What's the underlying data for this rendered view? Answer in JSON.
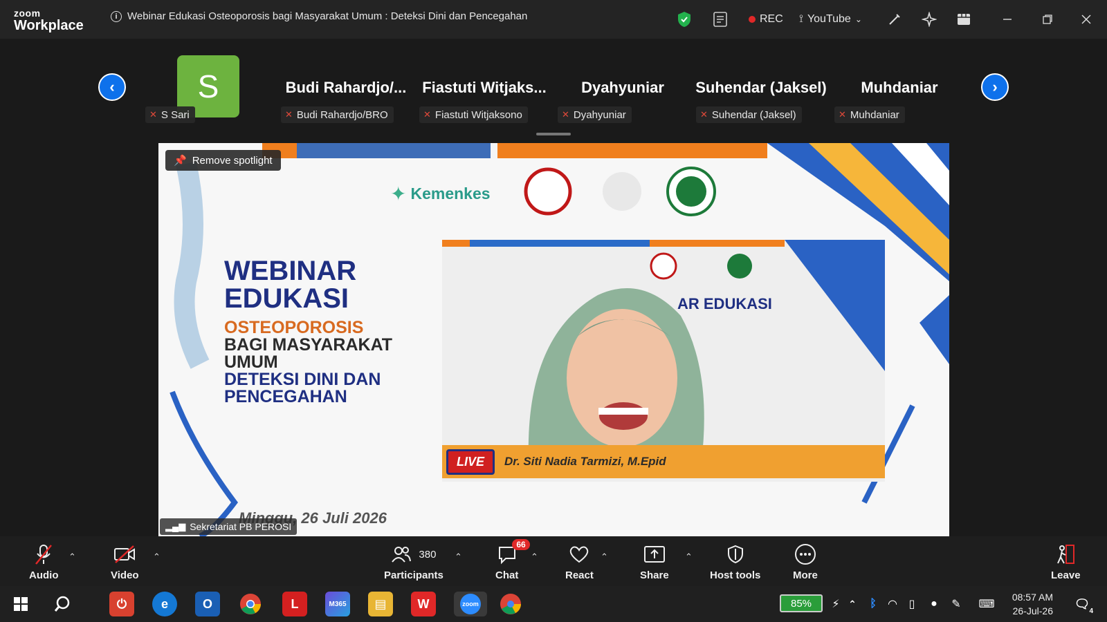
{
  "app": {
    "logo_top": "zoom",
    "logo_bottom": "Workplace"
  },
  "meeting": {
    "title": "Webinar Edukasi Osteoporosis bagi Masyarakat Umum : Deteksi Dini dan Pencegahan"
  },
  "titlebar": {
    "rec_label": "REC",
    "stream_label": "YouTube"
  },
  "participants_strip": [
    {
      "big": "",
      "avatar_letter": "S",
      "name": "S Sari"
    },
    {
      "big": "Budi  Rahardjo/...",
      "name": "Budi Rahardjo/BRO"
    },
    {
      "big": "Fiastuti  Witjaks...",
      "name": "Fiastuti Witjaksono"
    },
    {
      "big": "Dyahyuniar",
      "name": "Dyahyuniar"
    },
    {
      "big": "Suhendar (Jaksel)",
      "name": "Suhendar (Jaksel)"
    },
    {
      "big": "Muhdaniar",
      "name": "Muhdaniar"
    }
  ],
  "stage": {
    "spotlight_label": "Remove spotlight",
    "speaker_name": "Sekretariat PB PEROSI",
    "slide": {
      "brand": "Kemenkes",
      "line1": "WEBINAR",
      "line2": "EDUKASI",
      "line3": "OSTEOPOROSIS",
      "line4": "BAGI MASYARAKAT",
      "line5": "UMUM",
      "line6": "DETEKSI DINI DAN",
      "line7": "PENCEGAHAN",
      "date": "Minggu, 26 Juli 2026",
      "inner_title": "AR EDUKASI",
      "live_label": "LIVE",
      "presenter": "Dr. Siti Nadia Tarmizi, M.Epid"
    }
  },
  "toolbar": {
    "audio": "Audio",
    "video": "Video",
    "participants": "Participants",
    "participants_count": "380",
    "chat": "Chat",
    "chat_badge": "66",
    "react": "React",
    "share": "Share",
    "host_tools": "Host tools",
    "more": "More",
    "leave": "Leave"
  },
  "taskbar": {
    "battery": "85%",
    "time": "08:57 AM",
    "date": "26-Jul-26",
    "notif_count": "4"
  }
}
